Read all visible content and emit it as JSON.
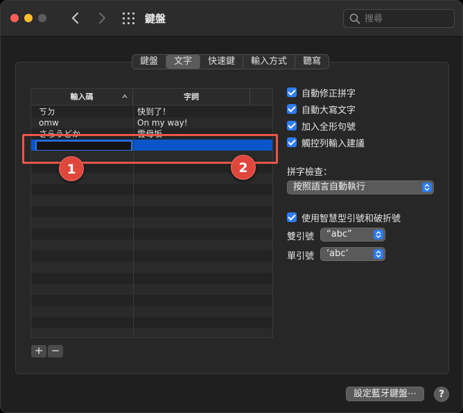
{
  "window": {
    "title": "鍵盤"
  },
  "search": {
    "placeholder": "搜尋"
  },
  "tabs": [
    {
      "label": "鍵盤"
    },
    {
      "label": "文字",
      "active": true
    },
    {
      "label": "快速鍵"
    },
    {
      "label": "輸入方式"
    },
    {
      "label": "聽寫"
    }
  ],
  "table": {
    "headers": {
      "input": "輸入碼",
      "phrase": "字詞"
    },
    "rows": [
      {
        "input": "ㄎㄉ",
        "phrase": "快到了！"
      },
      {
        "input": "omw",
        "phrase": "On my way!"
      },
      {
        "input": "さらうどか",
        "phrase": "雲母坂"
      },
      {
        "input": "",
        "phrase": ""
      }
    ]
  },
  "markers": {
    "one": "1",
    "two": "2"
  },
  "buttons": {
    "add": "+",
    "remove": "−"
  },
  "options": {
    "autocorrect": "自動修正拼字",
    "autocapitalize": "自動大寫文字",
    "add_period": "加入全形句號",
    "touchbar_suggestions": "觸控列輸入建議",
    "spelling_label": "拼字檢查：",
    "spelling_value": "按照語言自動執行",
    "smart_quotes": "使用智慧型引號和破折號",
    "double_quote_label": "雙引號",
    "double_quote_value": "“abc”",
    "single_quote_label": "單引號",
    "single_quote_value": "‘abc’"
  },
  "footer": {
    "bluetooth_button": "設定藍牙鍵盤⋯",
    "help": "?"
  },
  "colors": {
    "accent": "#2f7cf6",
    "selection": "#0a55c9",
    "marker": "#e0473c"
  }
}
